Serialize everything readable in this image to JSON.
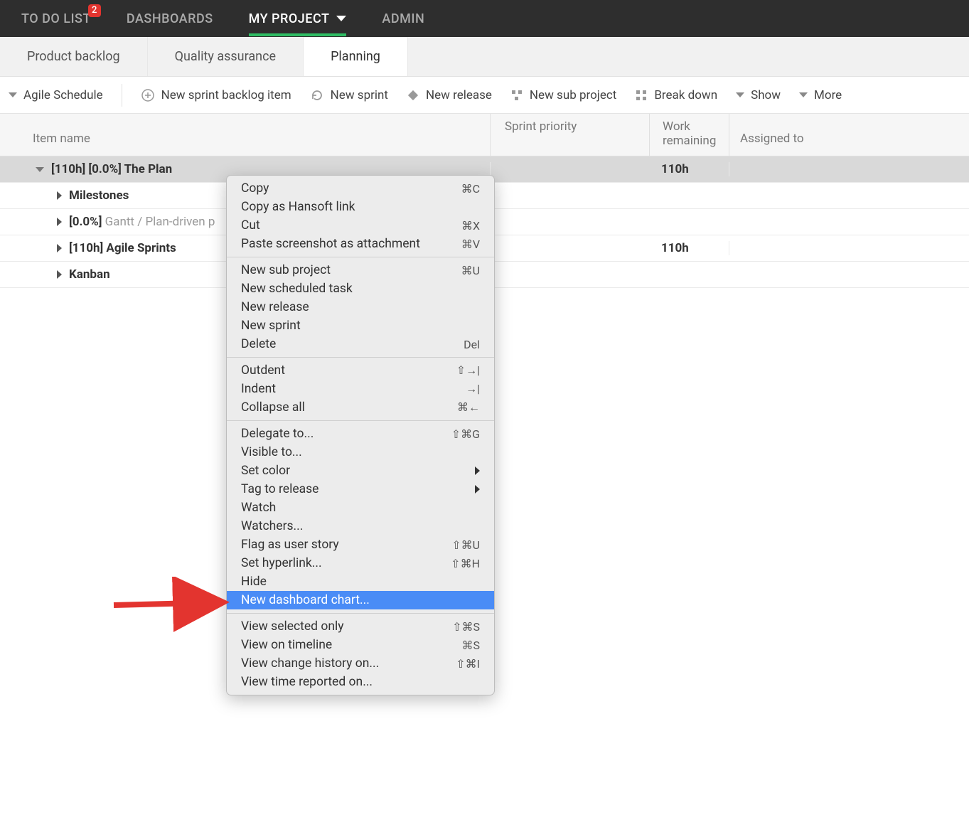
{
  "topnav": {
    "todo": "TO DO LIST",
    "todo_badge": "2",
    "dashboards": "DASHBOARDS",
    "myproject": "MY PROJECT",
    "admin": "ADMIN"
  },
  "subtabs": {
    "backlog": "Product backlog",
    "qa": "Quality assurance",
    "planning": "Planning"
  },
  "toolbar": {
    "agile_schedule": "Agile Schedule",
    "new_sprint_backlog": "New sprint backlog item",
    "new_sprint": "New sprint",
    "new_release": "New release",
    "new_sub_project": "New sub project",
    "break_down": "Break down",
    "show": "Show",
    "more": "More"
  },
  "columns": {
    "item_name": "Item name",
    "sprint_priority": "Sprint priority",
    "work_remaining": "Work remaining",
    "assigned_to": "Assigned to"
  },
  "rows": [
    {
      "name_prefix": "[110h] [0.0%] ",
      "name_main": "The Plan",
      "muted": "",
      "wr": "110h",
      "selected": true,
      "root": true
    },
    {
      "name_prefix": "",
      "name_main": "Milestones",
      "muted": "",
      "wr": "",
      "selected": false,
      "root": false
    },
    {
      "name_prefix": "[0.0%] ",
      "name_main": "",
      "muted": "Gantt / Plan-driven p",
      "wr": "",
      "selected": false,
      "root": false
    },
    {
      "name_prefix": "[110h] ",
      "name_main": "Agile Sprints",
      "muted": "",
      "wr": "110h",
      "selected": false,
      "root": false
    },
    {
      "name_prefix": "",
      "name_main": "Kanban",
      "muted": "",
      "wr": "",
      "selected": false,
      "root": false
    }
  ],
  "menu": {
    "groups": [
      [
        {
          "label": "Copy",
          "shortcut": "⌘C"
        },
        {
          "label": "Copy as Hansoft link",
          "shortcut": ""
        },
        {
          "label": "Cut",
          "shortcut": "⌘X"
        },
        {
          "label": "Paste screenshot as attachment",
          "shortcut": "⌘V"
        }
      ],
      [
        {
          "label": "New sub project",
          "shortcut": "⌘U"
        },
        {
          "label": "New scheduled task",
          "shortcut": ""
        },
        {
          "label": "New release",
          "shortcut": ""
        },
        {
          "label": "New sprint",
          "shortcut": ""
        },
        {
          "label": "Delete",
          "shortcut": "Del"
        }
      ],
      [
        {
          "label": "Outdent",
          "shortcut": "⇧→|"
        },
        {
          "label": "Indent",
          "shortcut": "→|"
        },
        {
          "label": "Collapse all",
          "shortcut": "⌘←"
        }
      ],
      [
        {
          "label": "Delegate to...",
          "shortcut": "⇧⌘G"
        },
        {
          "label": "Visible to...",
          "shortcut": ""
        },
        {
          "label": "Set color",
          "shortcut": "",
          "submenu": true
        },
        {
          "label": "Tag to release",
          "shortcut": "",
          "submenu": true
        },
        {
          "label": "Watch",
          "shortcut": ""
        },
        {
          "label": "Watchers...",
          "shortcut": ""
        },
        {
          "label": "Flag as user story",
          "shortcut": "⇧⌘U"
        },
        {
          "label": "Set hyperlink...",
          "shortcut": "⇧⌘H"
        },
        {
          "label": "Hide",
          "shortcut": ""
        },
        {
          "label": "New dashboard chart...",
          "shortcut": "",
          "highlighted": true
        }
      ],
      [
        {
          "label": "View selected only",
          "shortcut": "⇧⌘S"
        },
        {
          "label": "View on timeline",
          "shortcut": "⌘S"
        },
        {
          "label": "View change history on...",
          "shortcut": "⇧⌘I"
        },
        {
          "label": "View time reported on...",
          "shortcut": ""
        }
      ]
    ]
  }
}
